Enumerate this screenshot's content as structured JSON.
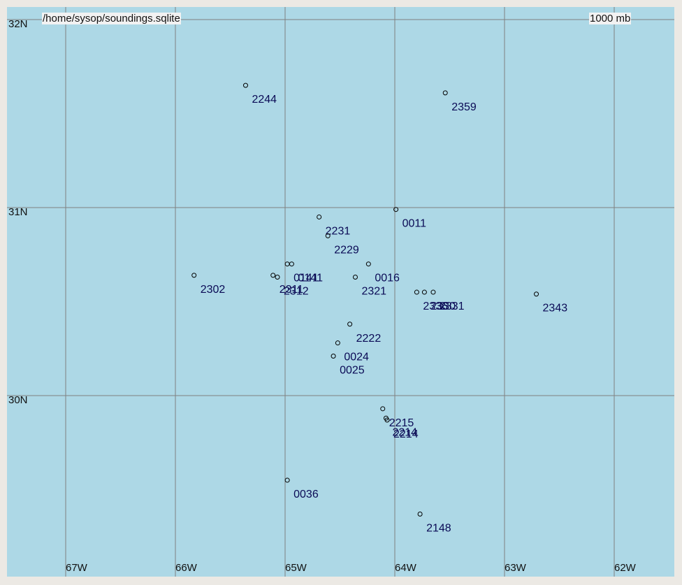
{
  "header": {
    "file_path": "/home/sysop/soundings.sqlite",
    "level": "1000 mb"
  },
  "map": {
    "background_color": "#add8e6",
    "grid_color": "#808080",
    "label_color": "#0a0a55",
    "latitudes": [
      {
        "lat": 32,
        "label": "32N"
      },
      {
        "lat": 31,
        "label": "31N"
      },
      {
        "lat": 30,
        "label": "30N"
      }
    ],
    "longitudes": [
      {
        "lon": -67,
        "label": "67W"
      },
      {
        "lon": -66,
        "label": "66W"
      },
      {
        "lon": -65,
        "label": "65W"
      },
      {
        "lon": -64,
        "label": "64W"
      },
      {
        "lon": -63,
        "label": "63W"
      },
      {
        "lon": -62,
        "label": "62W"
      }
    ],
    "stations": [
      {
        "id": "2244",
        "lon": -65.36,
        "lat": 31.65
      },
      {
        "id": "2359",
        "lon": -63.54,
        "lat": 31.61
      },
      {
        "id": "0011",
        "lon": -63.99,
        "lat": 30.99
      },
      {
        "id": "2231",
        "lon": -64.69,
        "lat": 30.95
      },
      {
        "id": "2229",
        "lon": -64.61,
        "lat": 30.85
      },
      {
        "id": "0141",
        "lon": -64.94,
        "lat": 30.7
      },
      {
        "id": "0141",
        "lon": -64.98,
        "lat": 30.7
      },
      {
        "id": "0016",
        "lon": -64.24,
        "lat": 30.7
      },
      {
        "id": "2302",
        "lon": -65.83,
        "lat": 30.64
      },
      {
        "id": "2311",
        "lon": -65.11,
        "lat": 30.64
      },
      {
        "id": "2312",
        "lon": -65.07,
        "lat": 30.63
      },
      {
        "id": "2321",
        "lon": -64.36,
        "lat": 30.63
      },
      {
        "id": "2336",
        "lon": -63.8,
        "lat": 30.55
      },
      {
        "id": "2330",
        "lon": -63.73,
        "lat": 30.55
      },
      {
        "id": "2331",
        "lon": -63.65,
        "lat": 30.55
      },
      {
        "id": "2343",
        "lon": -62.71,
        "lat": 30.54
      },
      {
        "id": "2222",
        "lon": -64.41,
        "lat": 30.38
      },
      {
        "id": "0024",
        "lon": -64.52,
        "lat": 30.28
      },
      {
        "id": "0025",
        "lon": -64.56,
        "lat": 30.21
      },
      {
        "id": "2215",
        "lon": -64.11,
        "lat": 29.93
      },
      {
        "id": "2214",
        "lon": -64.08,
        "lat": 29.88
      },
      {
        "id": "2214",
        "lon": -64.07,
        "lat": 29.87
      },
      {
        "id": "0036",
        "lon": -64.98,
        "lat": 29.55
      },
      {
        "id": "2148",
        "lon": -63.77,
        "lat": 29.37
      }
    ]
  }
}
